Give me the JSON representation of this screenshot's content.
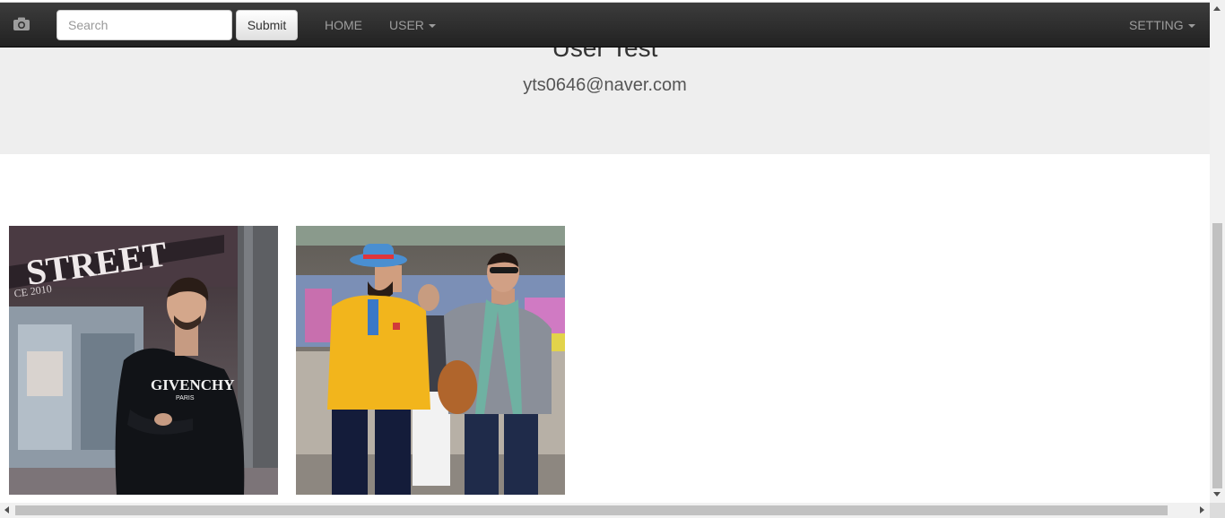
{
  "navbar": {
    "brand_icon": "camera-icon",
    "search": {
      "placeholder": "Search",
      "value": ""
    },
    "submit_label": "Submit",
    "home_label": "HOME",
    "user_label": "USER",
    "setting_label": "SETTING",
    "background": "#222222",
    "link_color": "#9d9d9d"
  },
  "profile": {
    "name": "User Test",
    "email": "yts0646@naver.com"
  },
  "gallery": {
    "photos": [
      {
        "subject": "man in black Givenchy sweatshirt in front of street store",
        "sign_text": "STREET",
        "sign_sub": "CE 2010",
        "shirt_text": "GIVENCHY",
        "shirt_sub": "PARIS"
      },
      {
        "subject": "two men walking, one in yellow double-breasted blazer and fedora, one in grey blazer with scarf"
      }
    ]
  },
  "colors": {
    "jumbotron": "#eeeeee",
    "page": "#ffffff"
  }
}
